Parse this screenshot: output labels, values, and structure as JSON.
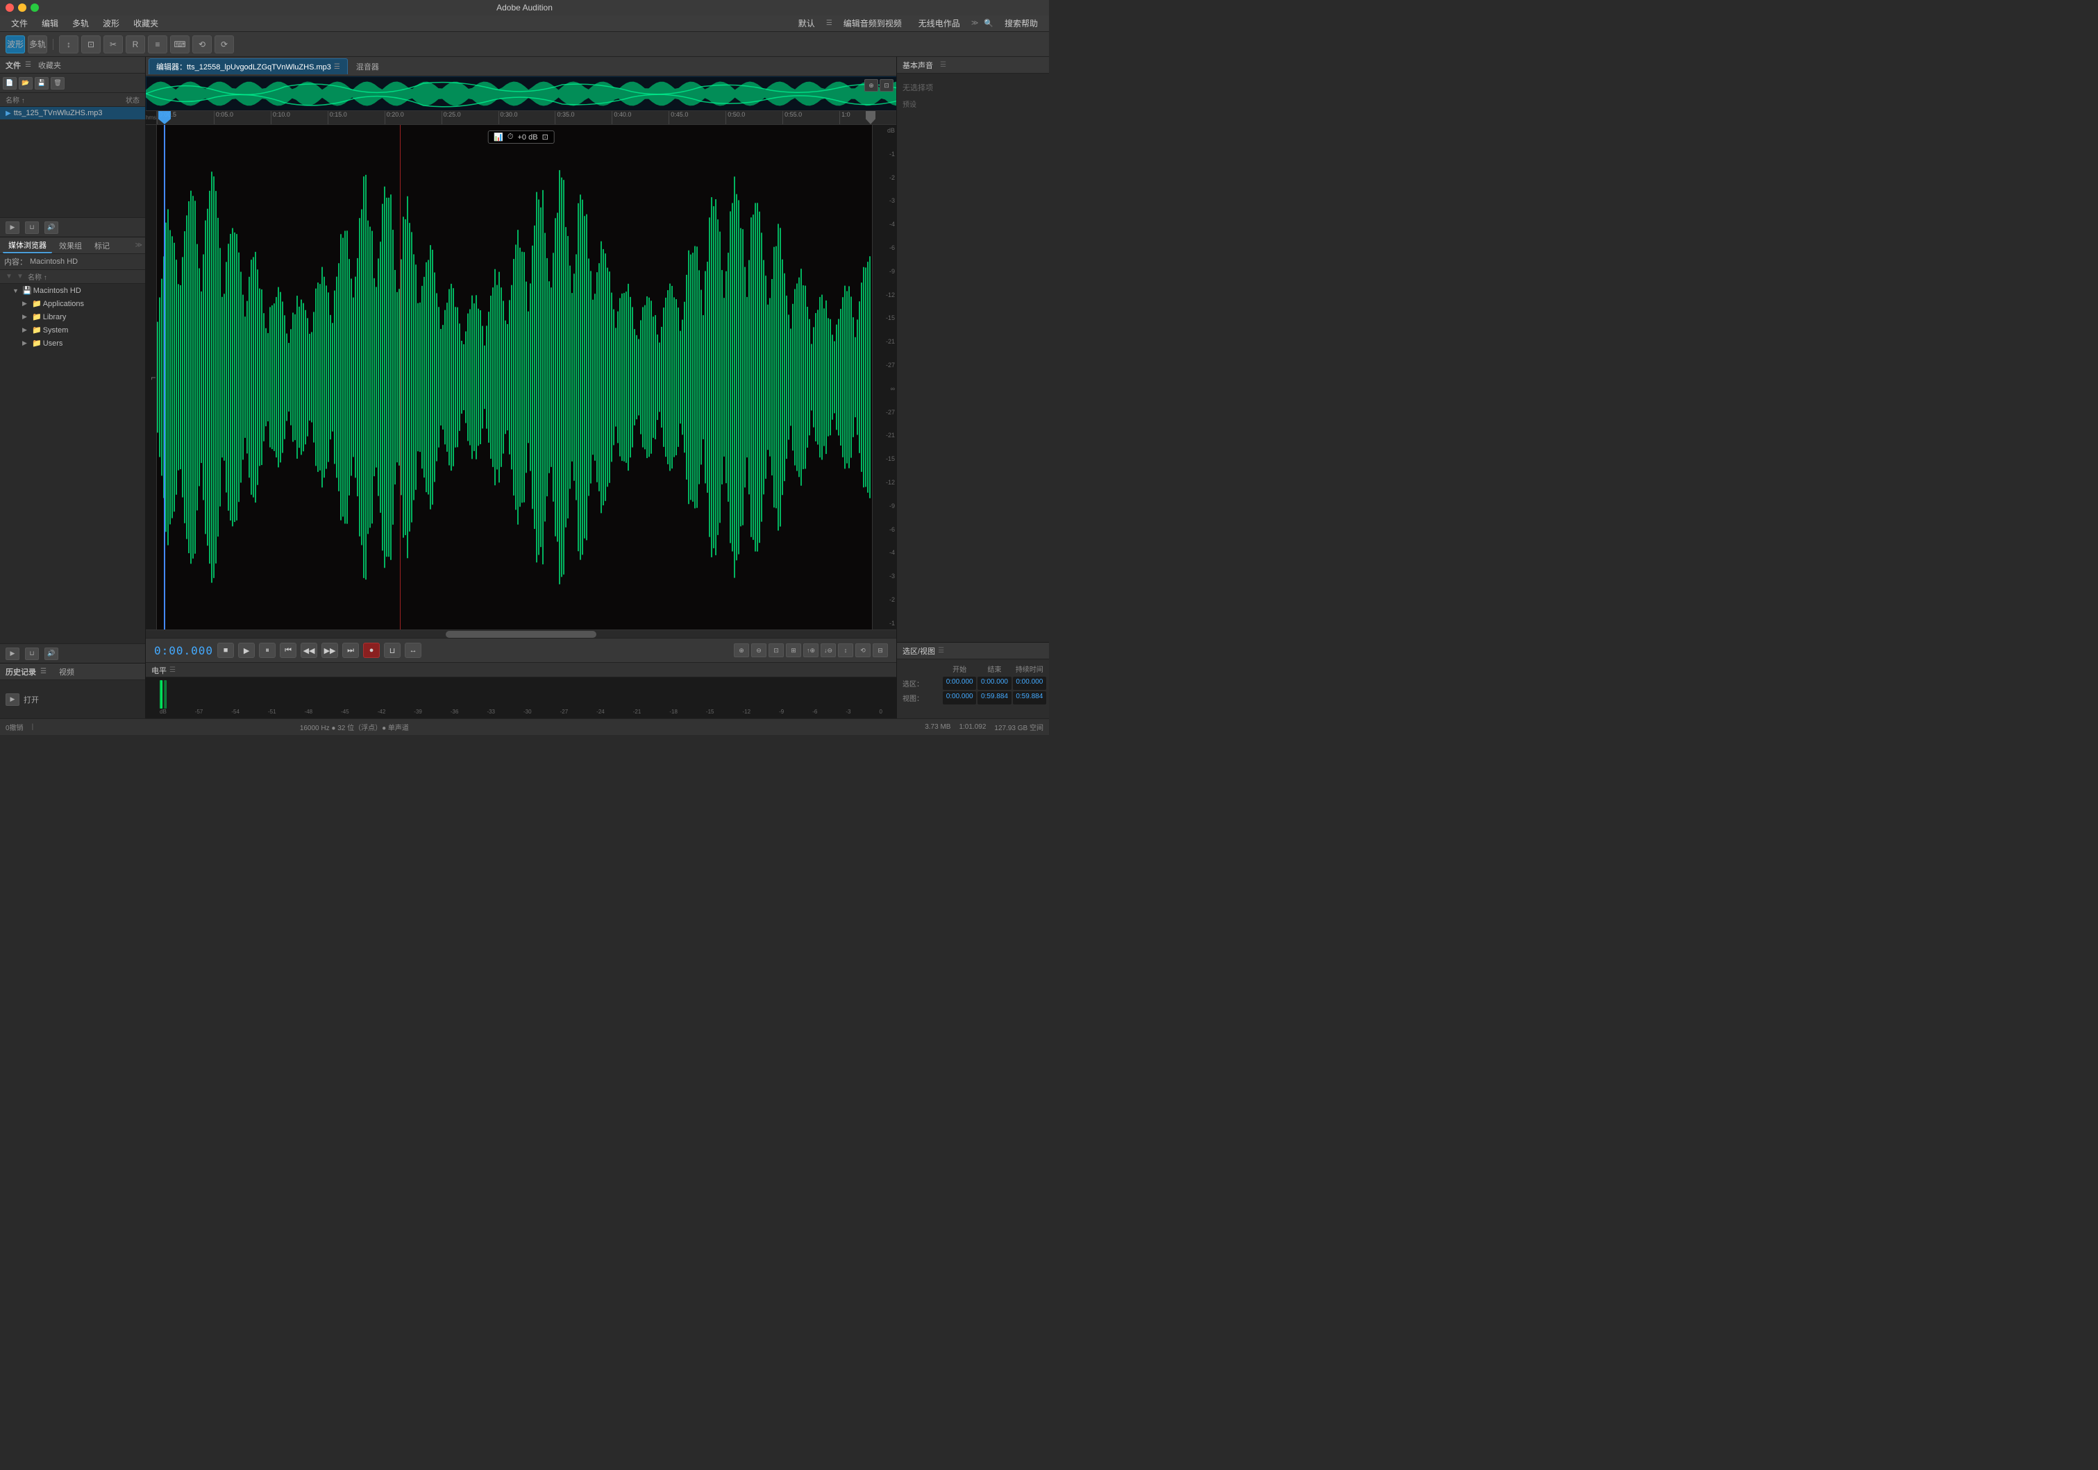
{
  "app": {
    "title": "Adobe Audition",
    "dots": [
      "red",
      "yellow",
      "green"
    ]
  },
  "menubar": {
    "items": [
      "文件",
      "编辑",
      "多轨",
      "波形",
      "收藏夹"
    ],
    "right_items": [
      "默认",
      "编辑音频到视频",
      "无线电作品",
      "搜索帮助"
    ]
  },
  "toolbar": {
    "tools": [
      "波形",
      "多轨",
      "工具1",
      "工具2",
      "工具3",
      "工具4",
      "工具5",
      "工具6",
      "工具7",
      "工具8"
    ]
  },
  "files_panel": {
    "title": "文件",
    "favorites": "收藏夹",
    "col_name": "名称 ↑",
    "col_status": "状态",
    "items": [
      {
        "name": "tts_125_TVnWluZHS.mp3",
        "active": true
      }
    ]
  },
  "media_browser": {
    "title": "媒体浏览器",
    "tabs": [
      "媒体浏览器",
      "效果组",
      "标记"
    ],
    "content_label": "内容：",
    "drive_name": "Macintosh HD",
    "col_name": "名称 ↑",
    "tree_items": [
      {
        "label": "Applications",
        "indent": 2,
        "has_arrow": true,
        "expanded": false,
        "is_folder": true
      },
      {
        "label": "Library",
        "indent": 2,
        "has_arrow": true,
        "expanded": false,
        "is_folder": true
      },
      {
        "label": "System",
        "indent": 2,
        "has_arrow": true,
        "expanded": false,
        "is_folder": true
      },
      {
        "label": "Users",
        "indent": 2,
        "has_arrow": true,
        "expanded": false,
        "is_folder": true
      }
    ]
  },
  "history": {
    "title": "历史记录",
    "video_tab": "视频",
    "items": [
      {
        "icon": "▶",
        "label": "打开"
      }
    ]
  },
  "editor": {
    "tab_label": "编辑器：tts_12558_lpUvgodLZGqTVnWluZHS.mp3",
    "mixer_label": "混音器",
    "gain_label": "+0 dB",
    "time_display": "0:00.000",
    "db_scale": [
      "dB",
      "-1",
      "-2",
      "-3",
      "-4",
      "-6",
      "-9",
      "-12",
      "-15",
      "-21",
      "-27",
      "∞",
      "-27",
      "-21",
      "-15",
      "-12",
      "-9",
      "-6",
      "-4",
      "-3",
      "-2",
      "-1"
    ],
    "ruler_marks": [
      "hms",
      "0:00.5",
      "0:05.0",
      "0:10.0",
      "0:15.0",
      "0:20.0",
      "0:25.0",
      "0:30.0",
      "0:35.0",
      "0:40.0",
      "0:45.0",
      "0:50.0",
      "0:55.0",
      "1:0"
    ]
  },
  "transport": {
    "time": "0:00.000",
    "buttons": [
      "■",
      "▶",
      "⏸",
      "⏮",
      "◀◀",
      "▶▶",
      "⏭",
      "●",
      "⊔",
      "↔"
    ]
  },
  "level_meter": {
    "title": "电平",
    "scale_marks": [
      "dB",
      "-57",
      "-54",
      "-51",
      "-48",
      "-45",
      "-42",
      "-39",
      "-36",
      "-33",
      "-30",
      "-27",
      "-24",
      "-21",
      "-18",
      "-15",
      "-12",
      "-9",
      "-6",
      "-3",
      "0"
    ]
  },
  "right_panel": {
    "title": "基本声音",
    "no_selection": "无选择项",
    "preset_label": "预设"
  },
  "selection_view": {
    "title": "选区/视图",
    "col_headers": [
      "开始",
      "结束",
      "持续时间"
    ],
    "rows": [
      {
        "label": "选区：",
        "values": [
          "0:00.000",
          "0:00.000",
          "0:00.000"
        ]
      },
      {
        "label": "视图：",
        "values": [
          "0:00.000",
          "0:59.884",
          "0:59.884"
        ]
      }
    ]
  },
  "status_bar": {
    "undo": "0撤销",
    "status": "",
    "sample_rate": "16000 Hz ● 32 位（浮点）● 单声道",
    "file_size": "3.73 MB",
    "duration": "1:01.092",
    "free_space": "127.93 GB 空间"
  }
}
